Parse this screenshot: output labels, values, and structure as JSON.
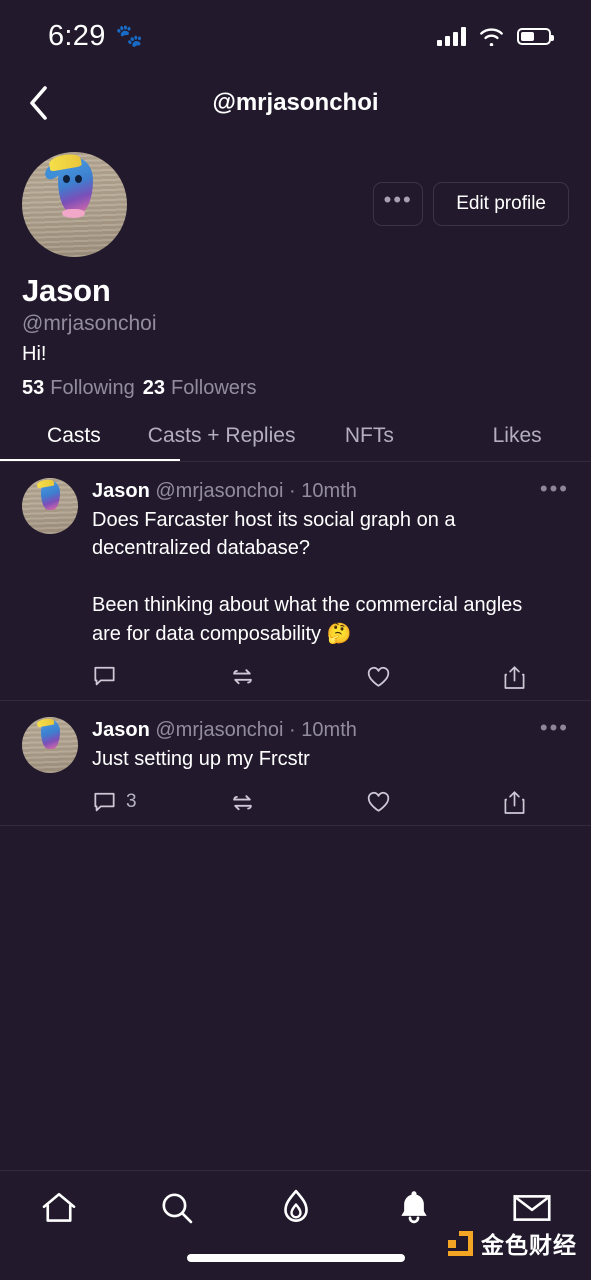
{
  "status_bar": {
    "time": "6:29",
    "paw_icon": "paw-print-icon",
    "signal_icon": "cellular-signal-icon",
    "wifi_icon": "wifi-icon",
    "battery_icon": "battery-icon",
    "battery_level": "50"
  },
  "header": {
    "back_icon": "chevron-left-icon",
    "title": "@mrjasonchoi"
  },
  "profile": {
    "avatar": "profile-avatar-image",
    "more_label": "•••",
    "edit_label": "Edit profile",
    "display_name": "Jason",
    "handle": "@mrjasonchoi",
    "bio": "Hi!",
    "following_count": "53",
    "following_label": "Following",
    "followers_count": "23",
    "followers_label": "Followers"
  },
  "tabs": [
    {
      "label": "Casts",
      "active": true
    },
    {
      "label": "Casts + Replies",
      "active": false
    },
    {
      "label": "NFTs",
      "active": false
    },
    {
      "label": "Likes",
      "active": false
    }
  ],
  "casts": [
    {
      "author": "Jason",
      "handle": "@mrjasonchoi",
      "separator": " · ",
      "time": "10mth",
      "text": "Does Farcaster host its social graph on a decentralized database?\n\nBeen thinking about what the commercial angles are for data composability 🤔",
      "more_label": "•••",
      "reply_count": "",
      "recast_count": "",
      "like_count": "",
      "share_count": ""
    },
    {
      "author": "Jason",
      "handle": "@mrjasonchoi",
      "separator": " · ",
      "time": "10mth",
      "text": "Just setting up my Frcstr",
      "more_label": "•••",
      "reply_count": "3",
      "recast_count": "",
      "like_count": "",
      "share_count": ""
    }
  ],
  "cast_action_icons": {
    "reply": "comment-bubble-icon",
    "recast": "recast-arrows-icon",
    "like": "heart-icon",
    "share": "share-upload-icon"
  },
  "bottom_nav": [
    {
      "icon": "home-icon",
      "name": "nav-home"
    },
    {
      "icon": "search-icon",
      "name": "nav-search"
    },
    {
      "icon": "flame-icon",
      "name": "nav-trending"
    },
    {
      "icon": "bell-icon",
      "name": "nav-notifications"
    },
    {
      "icon": "envelope-icon",
      "name": "nav-messages"
    }
  ],
  "watermark": {
    "text": "金色财经",
    "logo": "jinse-logo-icon",
    "color": "#f5a524"
  },
  "colors": {
    "background": "#221a2c",
    "divider": "#332a3e",
    "muted_text": "#938c9f",
    "primary_text": "#ffffff",
    "accent": "#f5a524"
  }
}
